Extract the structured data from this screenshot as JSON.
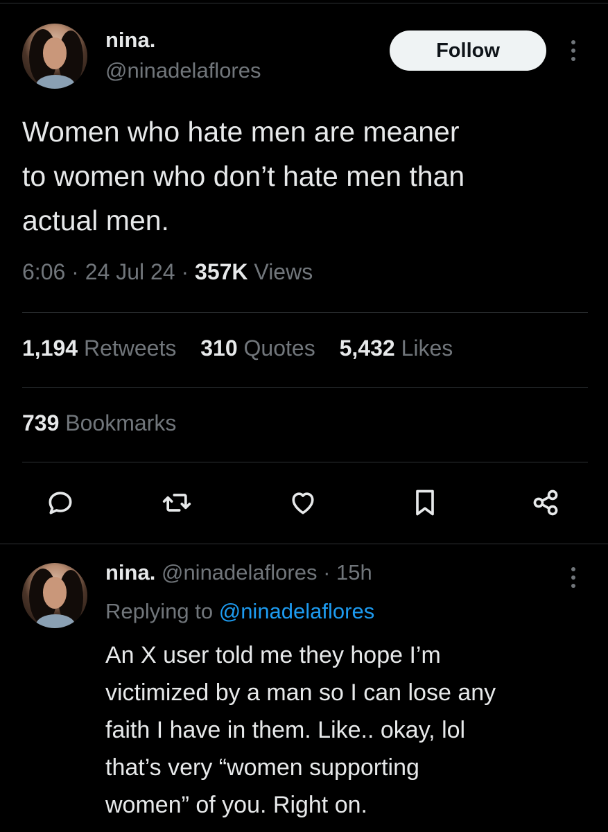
{
  "tweet": {
    "display_name": "nina.",
    "handle": "@ninadelaflores",
    "follow_label": "Follow",
    "text": "Women who hate men are meaner\nto women who don’t hate men than\nactual men.",
    "time": "6:06",
    "sep1": " · ",
    "date": "24 Jul 24",
    "sep2": " · ",
    "views_count": "357K",
    "views_label": " Views",
    "stats": {
      "retweets_count": "1,194",
      "retweets_label": "Retweets",
      "quotes_count": "310",
      "quotes_label": "Quotes",
      "likes_count": "5,432",
      "likes_label": "Likes",
      "bookmarks_count": "739",
      "bookmarks_label": "Bookmarks"
    },
    "actions": [
      "reply-icon",
      "retweet-icon",
      "heart-icon",
      "bookmark-icon",
      "share-icon"
    ]
  },
  "reply": {
    "display_name": "nina.",
    "handle": "@ninadelaflores",
    "dot": " · ",
    "time_ago": "15h",
    "replying_prefix": "Replying to ",
    "replying_handle": "@ninadelaflores",
    "text": "An X user told me they hope I’m\nvictimized by a man so I can lose any\nfaith I have in them. Like.. okay, lol\nthat’s very “women supporting\nwomen” of you. Right on."
  },
  "colors": {
    "background": "#000000",
    "text_primary": "#e7e9ea",
    "text_secondary": "#71767b",
    "link": "#1d9bf0",
    "divider": "#2f3336",
    "follow_bg": "#eff3f4"
  }
}
